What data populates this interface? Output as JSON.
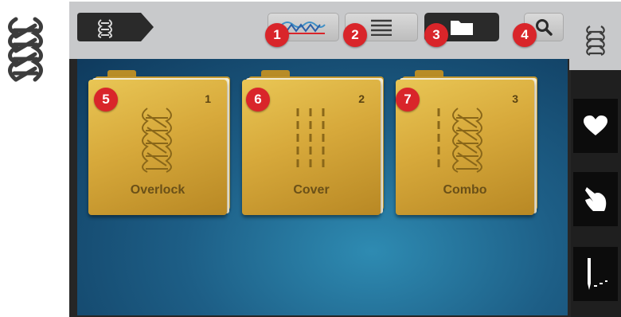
{
  "toolbar": {
    "mode_icon": "overlock-stitch-icon",
    "buttons": [
      {
        "icon": "stitch-wave-icon",
        "badge": "1"
      },
      {
        "icon": "list-icon",
        "badge": "2"
      },
      {
        "icon": "folder-icon",
        "badge": "3",
        "selected": true
      },
      {
        "icon": "search-icon",
        "badge": "4"
      }
    ]
  },
  "side_nav": {
    "tab_icon": "overlock-stitch-icon",
    "items": [
      {
        "icon": "heart-icon"
      },
      {
        "icon": "hand-icon"
      },
      {
        "icon": "needle-icon"
      }
    ]
  },
  "folders": [
    {
      "number": "1",
      "label": "Overlock",
      "badge": "5"
    },
    {
      "number": "2",
      "label": "Cover",
      "badge": "6"
    },
    {
      "number": "3",
      "label": "Combo",
      "badge": "7"
    }
  ],
  "colors": {
    "badge": "#d9252a",
    "folder_gold": "#d7a93b",
    "screen_blue": "#1d5e86"
  }
}
